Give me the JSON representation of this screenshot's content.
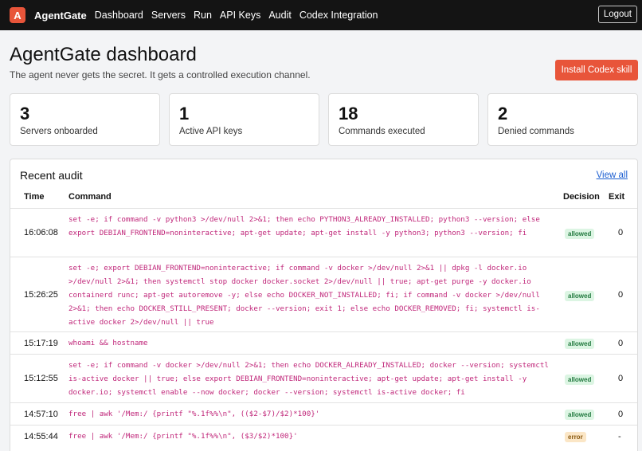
{
  "nav": {
    "logo_letter": "A",
    "brand": "AgentGate",
    "links": [
      "Dashboard",
      "Servers",
      "Run",
      "API Keys",
      "Audit",
      "Codex Integration"
    ],
    "logout": "Logout"
  },
  "header": {
    "title": "AgentGate dashboard",
    "subtitle": "The agent never gets the secret. It gets a controlled execution channel.",
    "install_button": "Install Codex skill"
  },
  "stats": [
    {
      "value": "3",
      "label": "Servers onboarded"
    },
    {
      "value": "1",
      "label": "Active API keys"
    },
    {
      "value": "18",
      "label": "Commands executed"
    },
    {
      "value": "2",
      "label": "Denied commands"
    }
  ],
  "audit": {
    "title": "Recent audit",
    "view_all": "View all",
    "columns": {
      "time": "Time",
      "command": "Command",
      "decision": "Decision",
      "exit": "Exit"
    },
    "rows": [
      {
        "time": "16:06:08",
        "command": "set -e; if command -v python3 >/dev/null 2>&1; then echo PYTHON3_ALREADY_INSTALLED; python3 --version; else export DEBIAN_FRONTEND=noninteractive; apt-get update; apt-get install -y python3; python3 --version; fi",
        "decision": "allowed",
        "exit": "0"
      },
      {
        "time": "15:26:25",
        "command": "set -e; export DEBIAN_FRONTEND=noninteractive; if command -v docker >/dev/null 2>&1 || dpkg -l docker.io >/dev/null 2>&1; then systemctl stop docker docker.socket 2>/dev/null || true; apt-get purge -y docker.io containerd runc; apt-get autoremove -y; else echo DOCKER_NOT_INSTALLED; fi; if command -v docker >/dev/null 2>&1; then echo DOCKER_STILL_PRESENT; docker --version; exit 1; else echo DOCKER_REMOVED; fi; systemctl is-active docker 2>/dev/null || true",
        "decision": "allowed",
        "exit": "0"
      },
      {
        "time": "15:17:19",
        "command": "whoami && hostname",
        "decision": "allowed",
        "exit": "0"
      },
      {
        "time": "15:12:55",
        "command": "set -e; if command -v docker >/dev/null 2>&1; then echo DOCKER_ALREADY_INSTALLED; docker --version; systemctl is-active docker || true; else export DEBIAN_FRONTEND=noninteractive; apt-get update; apt-get install -y docker.io; systemctl enable --now docker; docker --version; systemctl is-active docker; fi",
        "decision": "allowed",
        "exit": "0"
      },
      {
        "time": "14:57:10",
        "command": "free | awk '/Mem:/ {printf \"%.1f%%\\n\", (($2-$7)/$2)*100}'",
        "decision": "allowed",
        "exit": "0"
      },
      {
        "time": "14:55:44",
        "command": "free | awk '/Mem:/ {printf \"%.1f%%\\n\", ($3/$2)*100}'",
        "decision": "error",
        "exit": "-"
      }
    ]
  }
}
